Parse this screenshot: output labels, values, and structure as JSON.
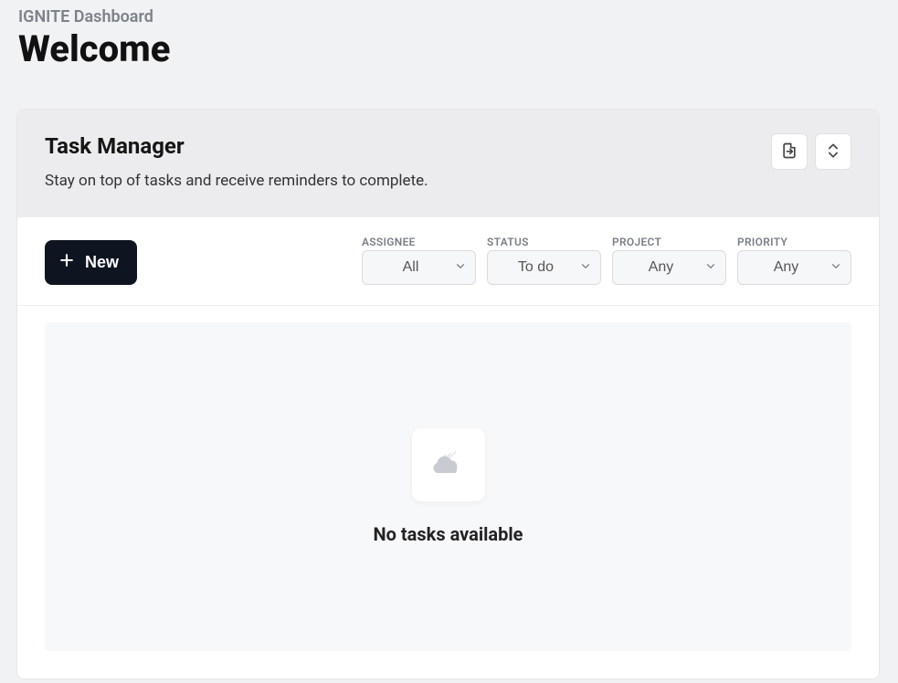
{
  "header": {
    "breadcrumb": "IGNITE Dashboard",
    "title": "Welcome"
  },
  "card": {
    "title": "Task Manager",
    "subtitle": "Stay on top of tasks and receive reminders to complete."
  },
  "toolbar": {
    "new_label": "New"
  },
  "filters": {
    "assignee": {
      "label": "ASSIGNEE",
      "value": "All"
    },
    "status": {
      "label": "STATUS",
      "value": "To do"
    },
    "project": {
      "label": "PROJECT",
      "value": "Any"
    },
    "priority": {
      "label": "PRIORITY",
      "value": "Any"
    }
  },
  "empty_state": {
    "message": "No tasks available"
  }
}
